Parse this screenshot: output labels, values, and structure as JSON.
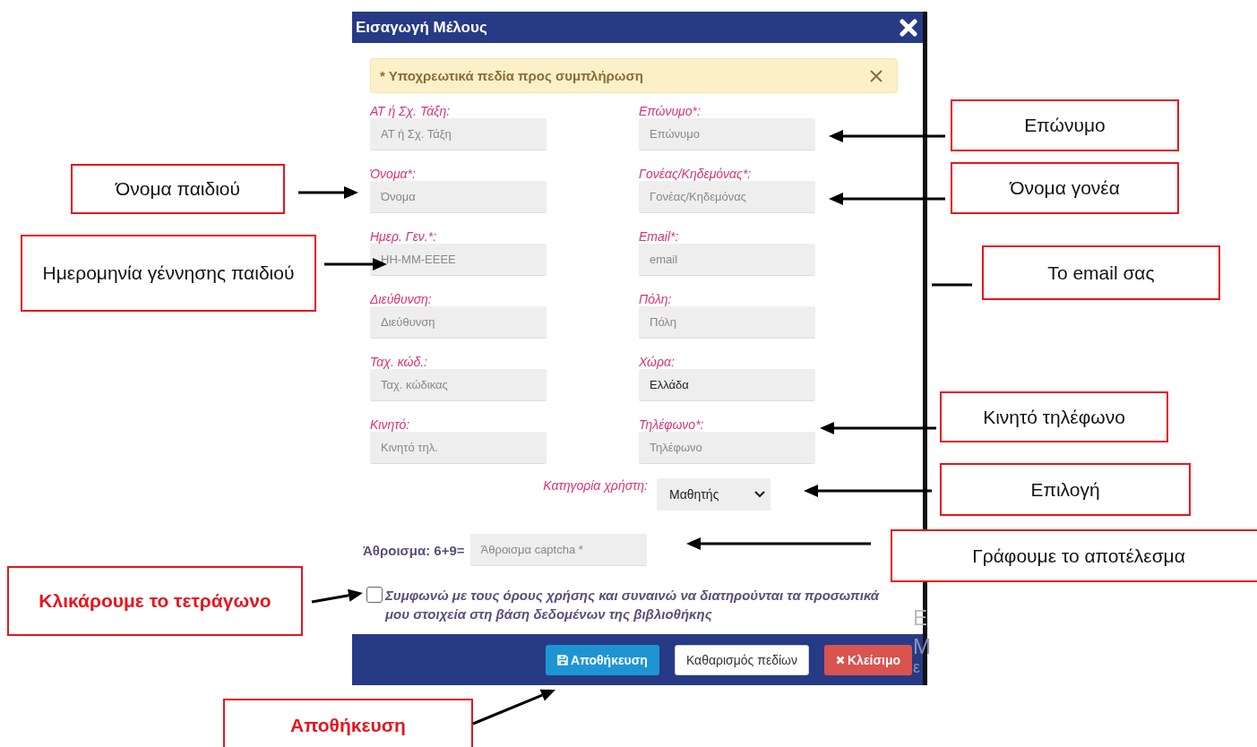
{
  "dialog": {
    "title": "Εισαγωγή Μέλους",
    "alert": {
      "text": "* Υποχρεωτικά πεδία προς συμπλήρωση"
    },
    "fields": [
      {
        "label": "ΑΤ ή Σχ. Τάξη:",
        "placeholder": "ΑΤ ή Σχ. Τάξη"
      },
      {
        "label": "Επώνυμο*:",
        "placeholder": "Επώνυμο"
      },
      {
        "label": "Όνομα*:",
        "placeholder": "Όνομα"
      },
      {
        "label": "Γονέας/Κηδεμόνας*:",
        "placeholder": "Γονέας/Κηδεμόνας"
      },
      {
        "label": "Ημερ. Γεν.*:",
        "placeholder": "HH-MM-EEEE"
      },
      {
        "label": "Email*:",
        "placeholder": "email"
      },
      {
        "label": "Διεύθυνση:",
        "placeholder": "Διεύθυνση"
      },
      {
        "label": "Πόλη:",
        "placeholder": "Πόλη"
      },
      {
        "label": "Ταχ. κώδ.:",
        "placeholder": "Ταχ. κώδικας"
      },
      {
        "label": "Χώρα:",
        "value": "Ελλάδα"
      },
      {
        "label": "Κινητό:",
        "placeholder": "Κινητό τηλ."
      },
      {
        "label": "Τηλέφωνο*:",
        "placeholder": "Τηλέφωνο"
      }
    ],
    "category": {
      "label": "Κατηγορία χρήστη:",
      "value": "Μαθητής"
    },
    "captcha": {
      "label": "Άθροισμα: 6+9=",
      "placeholder": "Άθροισμα captcha *"
    },
    "agreement": {
      "text": "Συμφωνώ με τους όρους χρήσης και συναινώ να διατηρούνται τα προσωπικά μου στοιχεία στη βάση δεδομένων της βιβλιοθήκης",
      "checked": false
    },
    "buttons": [
      {
        "label": "Αποθήκευση",
        "kind": "save"
      },
      {
        "label": "Καθαρισμός πεδίων",
        "kind": "reset"
      },
      {
        "label": "Κλείσιμο",
        "kind": "close"
      }
    ]
  },
  "background_fragments": [
    "Ε",
    "Μ",
    "ε"
  ],
  "annotations": [
    {
      "text": "Επώνυμο",
      "kind": "note"
    },
    {
      "text": "Όνομα παιδιού",
      "kind": "note"
    },
    {
      "text": "Όνομα γονέα",
      "kind": "note"
    },
    {
      "text": "Ημερομηνία γέννησης παιδιού",
      "kind": "note"
    },
    {
      "text": "Το email σας",
      "kind": "note"
    },
    {
      "text": "Κινητό τηλέφωνο",
      "kind": "note"
    },
    {
      "text": "Επιλογή",
      "kind": "note"
    },
    {
      "text": "Γράφουμε το αποτέλεσμα",
      "kind": "note"
    },
    {
      "text": "Κλικάρουμε το τετράγωνο",
      "kind": "emphasis"
    },
    {
      "text": "Αποθήκευση",
      "kind": "emphasis"
    }
  ]
}
